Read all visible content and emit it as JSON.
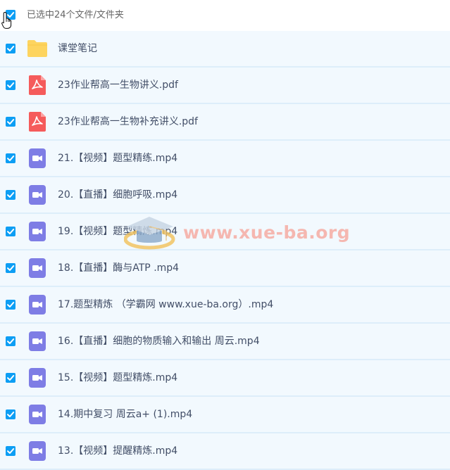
{
  "header": {
    "selection_text": "已选中24个文件/文件夹"
  },
  "files": [
    {
      "type": "folder",
      "name": "课堂笔记"
    },
    {
      "type": "pdf",
      "name": "23作业帮高一生物讲义.pdf"
    },
    {
      "type": "pdf",
      "name": "23作业帮高一生物补充讲义.pdf"
    },
    {
      "type": "video",
      "name": "21.【视频】题型精练.mp4"
    },
    {
      "type": "video",
      "name": "20.【直播】细胞呼吸.mp4"
    },
    {
      "type": "video",
      "name": "19.【视频】题型精炼.mp4"
    },
    {
      "type": "video",
      "name": "18.【直播】酶与ATP .mp4"
    },
    {
      "type": "video",
      "name": "17.题型精炼 （学霸网 www.xue-ba.org）.mp4"
    },
    {
      "type": "video",
      "name": "16.【直播】细胞的物质输入和输出 周云.mp4"
    },
    {
      "type": "video",
      "name": "15.【视频】题型精炼.mp4"
    },
    {
      "type": "video",
      "name": "14.期中复习 周云a+ (1).mp4"
    },
    {
      "type": "video",
      "name": "13.【视频】提醒精炼.mp4"
    }
  ],
  "watermark": {
    "text": "www.xue-ba.org"
  },
  "colors": {
    "checkbox": "#0d9ef4",
    "row_bg": "#f2f9fe",
    "folder": "#fdd45f",
    "pdf": "#f55b5b",
    "video": "#7e7de5"
  }
}
